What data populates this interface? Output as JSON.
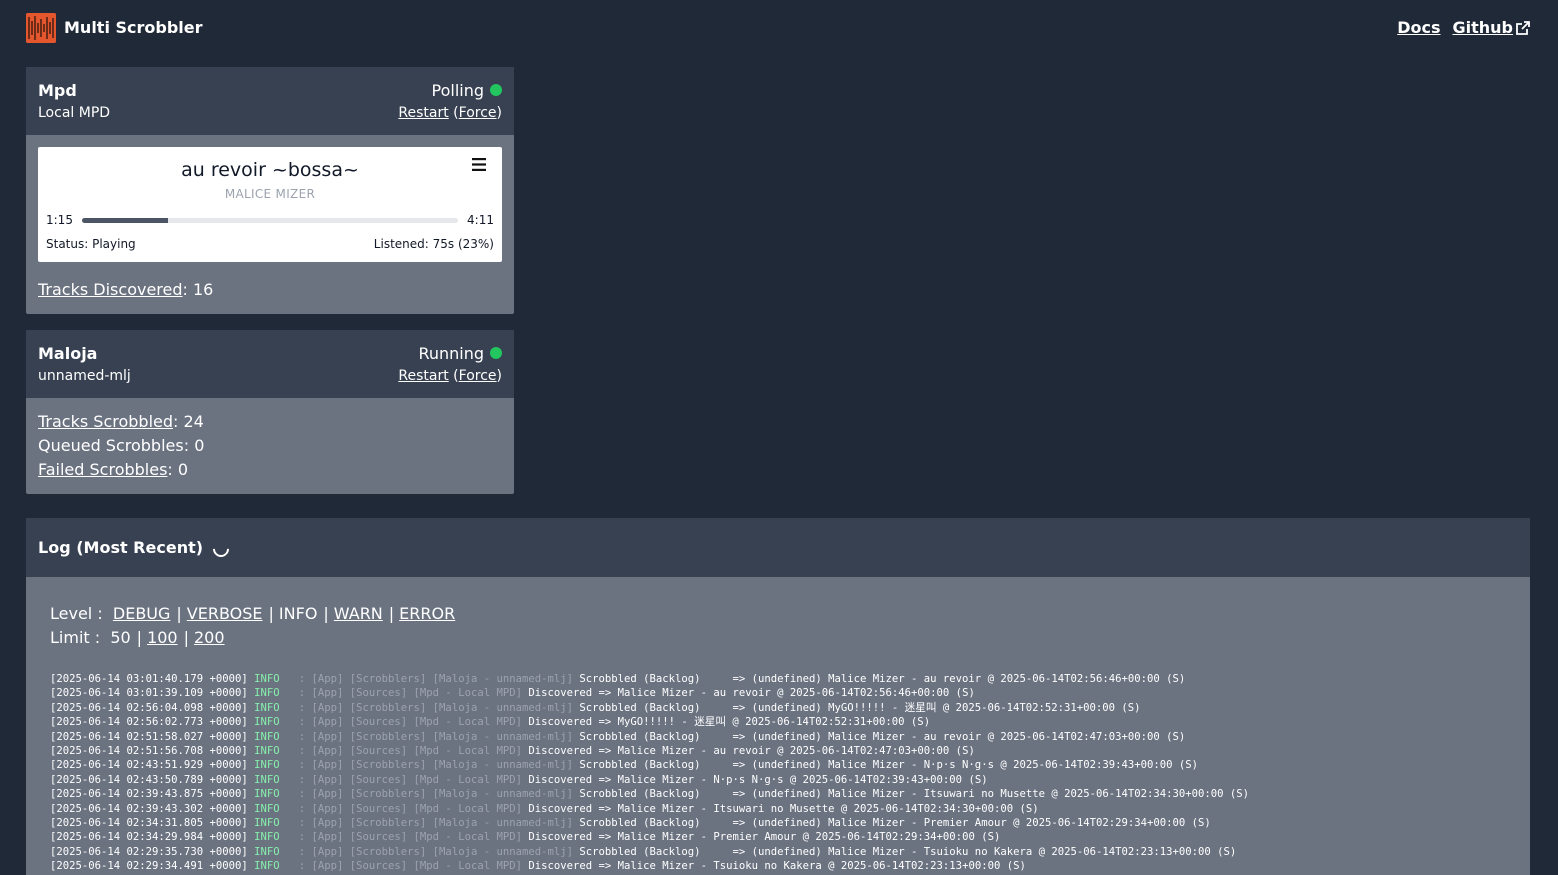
{
  "header": {
    "app_name": "Multi Scrobbler",
    "nav": {
      "docs": "Docs",
      "github": "Github"
    }
  },
  "sources": [
    {
      "name": "Mpd",
      "subtitle": "Local MPD",
      "status": "Polling",
      "status_color": "#22c55e",
      "restart_label": "Restart",
      "force_label": "Force",
      "player": {
        "track": "au revoir ~bossa~",
        "artist": "MALICE MIZER",
        "position": "1:15",
        "duration": "4:11",
        "progress_fraction": 0.23,
        "status": "Status: Playing",
        "listened": "Listened: 75s (23%)"
      },
      "stats": {
        "tracks_discovered_label": "Tracks Discovered",
        "tracks_discovered_value": ": 16"
      }
    }
  ],
  "clients": [
    {
      "name": "Maloja",
      "subtitle": "unnamed-mlj",
      "status": "Running",
      "status_color": "#22c55e",
      "restart_label": "Restart",
      "force_label": "Force",
      "stats": {
        "scrobbled_label": "Tracks Scrobbled",
        "scrobbled_value": ": 24",
        "queued": "Queued Scrobbles: 0",
        "failed_label": "Failed Scrobbles",
        "failed_value": ": 0"
      }
    }
  ],
  "log": {
    "title": "Log (Most Recent)",
    "level_label": "Level :",
    "levels": [
      "DEBUG",
      "VERBOSE",
      "INFO",
      "WARN",
      "ERROR"
    ],
    "active_level": "INFO",
    "limit_label": "Limit :",
    "limits": [
      "50",
      "100",
      "200"
    ],
    "active_limit": "50",
    "lines": [
      {
        "ts": "[2025-06-14 03:01:40.179 +0000]",
        "level": "INFO",
        "labels": "   : [App] [Scrobblers] [Maloja - unnamed-mlj]",
        "msg": " Scrobbled (Backlog)     => (undefined) Malice Mizer - au revoir @ 2025-06-14T02:56:46+00:00 (S)"
      },
      {
        "ts": "[2025-06-14 03:01:39.109 +0000]",
        "level": "INFO",
        "labels": "   : [App] [Sources] [Mpd - Local MPD]",
        "msg": " Discovered => Malice Mizer - au revoir @ 2025-06-14T02:56:46+00:00 (S)"
      },
      {
        "ts": "[2025-06-14 02:56:04.098 +0000]",
        "level": "INFO",
        "labels": "   : [App] [Scrobblers] [Maloja - unnamed-mlj]",
        "msg": " Scrobbled (Backlog)     => (undefined) MyGO!!!!! - 迷星叫 @ 2025-06-14T02:52:31+00:00 (S)"
      },
      {
        "ts": "[2025-06-14 02:56:02.773 +0000]",
        "level": "INFO",
        "labels": "   : [App] [Sources] [Mpd - Local MPD]",
        "msg": " Discovered => MyGO!!!!! - 迷星叫 @ 2025-06-14T02:52:31+00:00 (S)"
      },
      {
        "ts": "[2025-06-14 02:51:58.027 +0000]",
        "level": "INFO",
        "labels": "   : [App] [Scrobblers] [Maloja - unnamed-mlj]",
        "msg": " Scrobbled (Backlog)     => (undefined) Malice Mizer - au revoir @ 2025-06-14T02:47:03+00:00 (S)"
      },
      {
        "ts": "[2025-06-14 02:51:56.708 +0000]",
        "level": "INFO",
        "labels": "   : [App] [Sources] [Mpd - Local MPD]",
        "msg": " Discovered => Malice Mizer - au revoir @ 2025-06-14T02:47:03+00:00 (S)"
      },
      {
        "ts": "[2025-06-14 02:43:51.929 +0000]",
        "level": "INFO",
        "labels": "   : [App] [Scrobblers] [Maloja - unnamed-mlj]",
        "msg": " Scrobbled (Backlog)     => (undefined) Malice Mizer - N·p·s N·g·s @ 2025-06-14T02:39:43+00:00 (S)"
      },
      {
        "ts": "[2025-06-14 02:43:50.789 +0000]",
        "level": "INFO",
        "labels": "   : [App] [Sources] [Mpd - Local MPD]",
        "msg": " Discovered => Malice Mizer - N·p·s N·g·s @ 2025-06-14T02:39:43+00:00 (S)"
      },
      {
        "ts": "[2025-06-14 02:39:43.875 +0000]",
        "level": "INFO",
        "labels": "   : [App] [Scrobblers] [Maloja - unnamed-mlj]",
        "msg": " Scrobbled (Backlog)     => (undefined) Malice Mizer - Itsuwari no Musette @ 2025-06-14T02:34:30+00:00 (S)"
      },
      {
        "ts": "[2025-06-14 02:39:43.302 +0000]",
        "level": "INFO",
        "labels": "   : [App] [Sources] [Mpd - Local MPD]",
        "msg": " Discovered => Malice Mizer - Itsuwari no Musette @ 2025-06-14T02:34:30+00:00 (S)"
      },
      {
        "ts": "[2025-06-14 02:34:31.805 +0000]",
        "level": "INFO",
        "labels": "   : [App] [Scrobblers] [Maloja - unnamed-mlj]",
        "msg": " Scrobbled (Backlog)     => (undefined) Malice Mizer - Premier Amour @ 2025-06-14T02:29:34+00:00 (S)"
      },
      {
        "ts": "[2025-06-14 02:34:29.984 +0000]",
        "level": "INFO",
        "labels": "   : [App] [Sources] [Mpd - Local MPD]",
        "msg": " Discovered => Malice Mizer - Premier Amour @ 2025-06-14T02:29:34+00:00 (S)"
      },
      {
        "ts": "[2025-06-14 02:29:35.730 +0000]",
        "level": "INFO",
        "labels": "   : [App] [Scrobblers] [Maloja - unnamed-mlj]",
        "msg": " Scrobbled (Backlog)     => (undefined) Malice Mizer - Tsuioku no Kakera @ 2025-06-14T02:23:13+00:00 (S)"
      },
      {
        "ts": "[2025-06-14 02:29:34.491 +0000]",
        "level": "INFO",
        "labels": "   : [App] [Sources] [Mpd - Local MPD]",
        "msg": " Discovered => Malice Mizer - Tsuioku no Kakera @ 2025-06-14T02:23:13+00:00 (S)"
      }
    ]
  }
}
